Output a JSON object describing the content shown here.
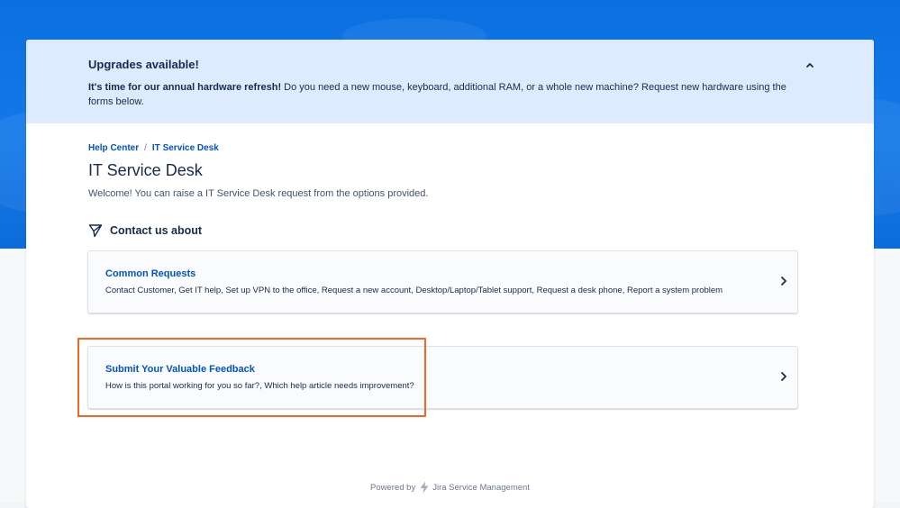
{
  "announcement": {
    "title": "Upgrades available!",
    "body_bold": "It's time for our annual hardware refresh!",
    "body_rest": " Do you need a new mouse, keyboard, additional RAM, or a whole new machine? Request new hardware using the forms below."
  },
  "breadcrumb": {
    "items": [
      "Help Center",
      "IT Service Desk"
    ],
    "separator": "/"
  },
  "page": {
    "title": "IT Service Desk",
    "welcome": "Welcome! You can raise a IT Service Desk request from the options provided."
  },
  "section": {
    "title": "Contact us about"
  },
  "cards": [
    {
      "title": "Common Requests",
      "description": "Contact Customer, Get IT help, Set up VPN to the office, Request a new account, Desktop/Laptop/Tablet support, Request a desk phone, Report a system problem"
    },
    {
      "title": "Submit Your Valuable Feedback",
      "description": "How is this portal working for you so far?, Which help article needs improvement?"
    }
  ],
  "footer": {
    "prefix": "Powered by",
    "product": "Jira Service Management"
  },
  "colors": {
    "brand_blue": "#0052cc",
    "hero_blue": "#1479e8",
    "highlight_orange": "#f26522",
    "announce_bg": "#deebff"
  },
  "icons": {
    "collapse": "chevron-up-icon",
    "section": "paper-plane-icon",
    "card_arrow": "chevron-right-icon",
    "footer_logo": "jira-lightning-icon"
  }
}
